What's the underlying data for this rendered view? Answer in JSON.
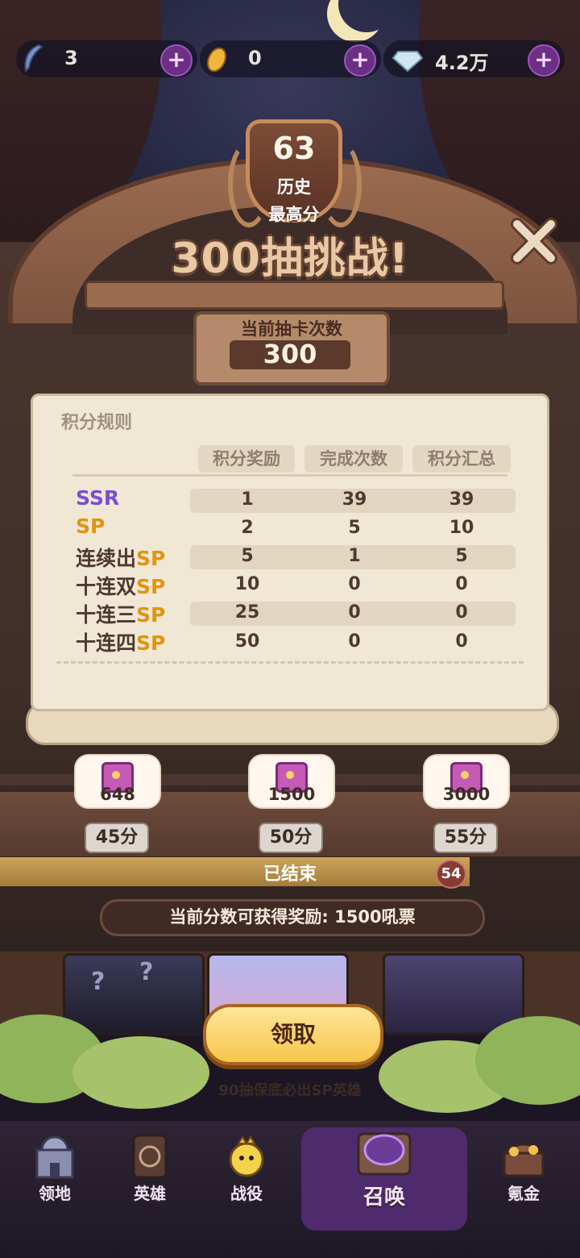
{
  "currency": [
    {
      "icon": "feather-icon",
      "value": "3"
    },
    {
      "icon": "meteor-icon",
      "value": "0"
    },
    {
      "icon": "diamond-icon",
      "value": "4.2万"
    }
  ],
  "best": {
    "score": "63",
    "label_line1": "历史",
    "label_line2": "最高分"
  },
  "title": "300抽挑战!",
  "draws": {
    "label": "当前抽卡次数",
    "value": "300"
  },
  "rules": {
    "title": "积分规则",
    "headers": [
      "积分奖励",
      "完成次数",
      "积分汇总"
    ],
    "rows": [
      {
        "label_prefix": "",
        "label_sp": "",
        "label_ssr": "SSR",
        "points": "1",
        "count": "39",
        "total": "39"
      },
      {
        "label_prefix": "",
        "label_sp": "SP",
        "label_ssr": "",
        "points": "2",
        "count": "5",
        "total": "10"
      },
      {
        "label_prefix": "连续出",
        "label_sp": "SP",
        "label_ssr": "",
        "points": "5",
        "count": "1",
        "total": "5"
      },
      {
        "label_prefix": "十连双",
        "label_sp": "SP",
        "label_ssr": "",
        "points": "10",
        "count": "0",
        "total": "0"
      },
      {
        "label_prefix": "十连三",
        "label_sp": "SP",
        "label_ssr": "",
        "points": "25",
        "count": "0",
        "total": "0"
      },
      {
        "label_prefix": "十连四",
        "label_sp": "SP",
        "label_ssr": "",
        "points": "50",
        "count": "0",
        "total": "0"
      }
    ]
  },
  "milestones": [
    {
      "reward": "648",
      "points": "45分"
    },
    {
      "reward": "1500",
      "points": "50分"
    },
    {
      "reward": "3000",
      "points": "55分"
    }
  ],
  "progress": {
    "status": "已结束",
    "score": "54",
    "fill_fraction": 0.81
  },
  "current_reward": "当前分数可获得奖励: 1500吼票",
  "pool_marks": [
    "?",
    "?"
  ],
  "claim_label": "领取",
  "guarantee": "90抽保底必出SP英雄",
  "nav": [
    {
      "label": "领地",
      "icon": "castle-icon"
    },
    {
      "label": "英雄",
      "icon": "spellbook-icon"
    },
    {
      "label": "战役",
      "icon": "chick-warrior-icon"
    },
    {
      "label": "召唤",
      "icon": "summon-circle-icon"
    },
    {
      "label": "氪金",
      "icon": "treasure-chest-icon"
    }
  ],
  "colors": {
    "sp": "#e0950f",
    "ssr": "#7a4fd1",
    "button": "#f7c54b"
  }
}
